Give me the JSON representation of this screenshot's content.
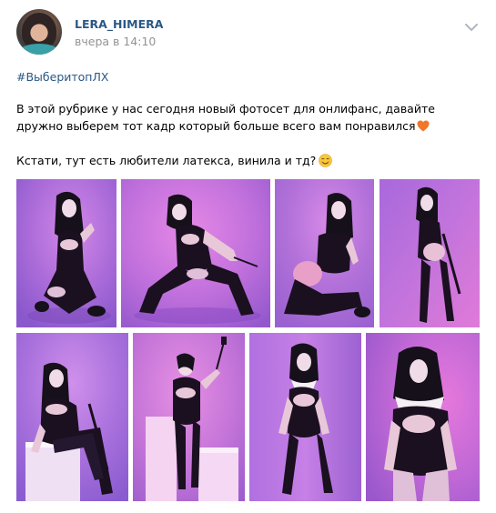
{
  "author": {
    "name": "LERA_HIMERA",
    "avatar_icon": "user-avatar"
  },
  "post": {
    "time": "вчера в 14:10",
    "hashtag": "#ВыберитопЛХ",
    "paragraph_1": "В этой рубрике у нас сегодня новый фотосет для онлифанс, давайте дружно выберем тот кадр который больше всего вам понравился",
    "paragraph_1_emoji": "orange-heart-icon",
    "paragraph_2": "Кстати, тут есть любители латекса, винила и тд?",
    "paragraph_2_emoji": "smiling-face-icon",
    "menu_icon": "chevron-down-icon"
  },
  "photos": {
    "count": 8,
    "colors": {
      "background_pink": "#e070d8",
      "background_violet": "#8a5ad8",
      "outfit": "#1a1020",
      "skin": "#e8c8c8"
    }
  },
  "colors": {
    "link": "#2a5885",
    "muted": "#939393",
    "text": "#000000",
    "background": "#ffffff"
  }
}
